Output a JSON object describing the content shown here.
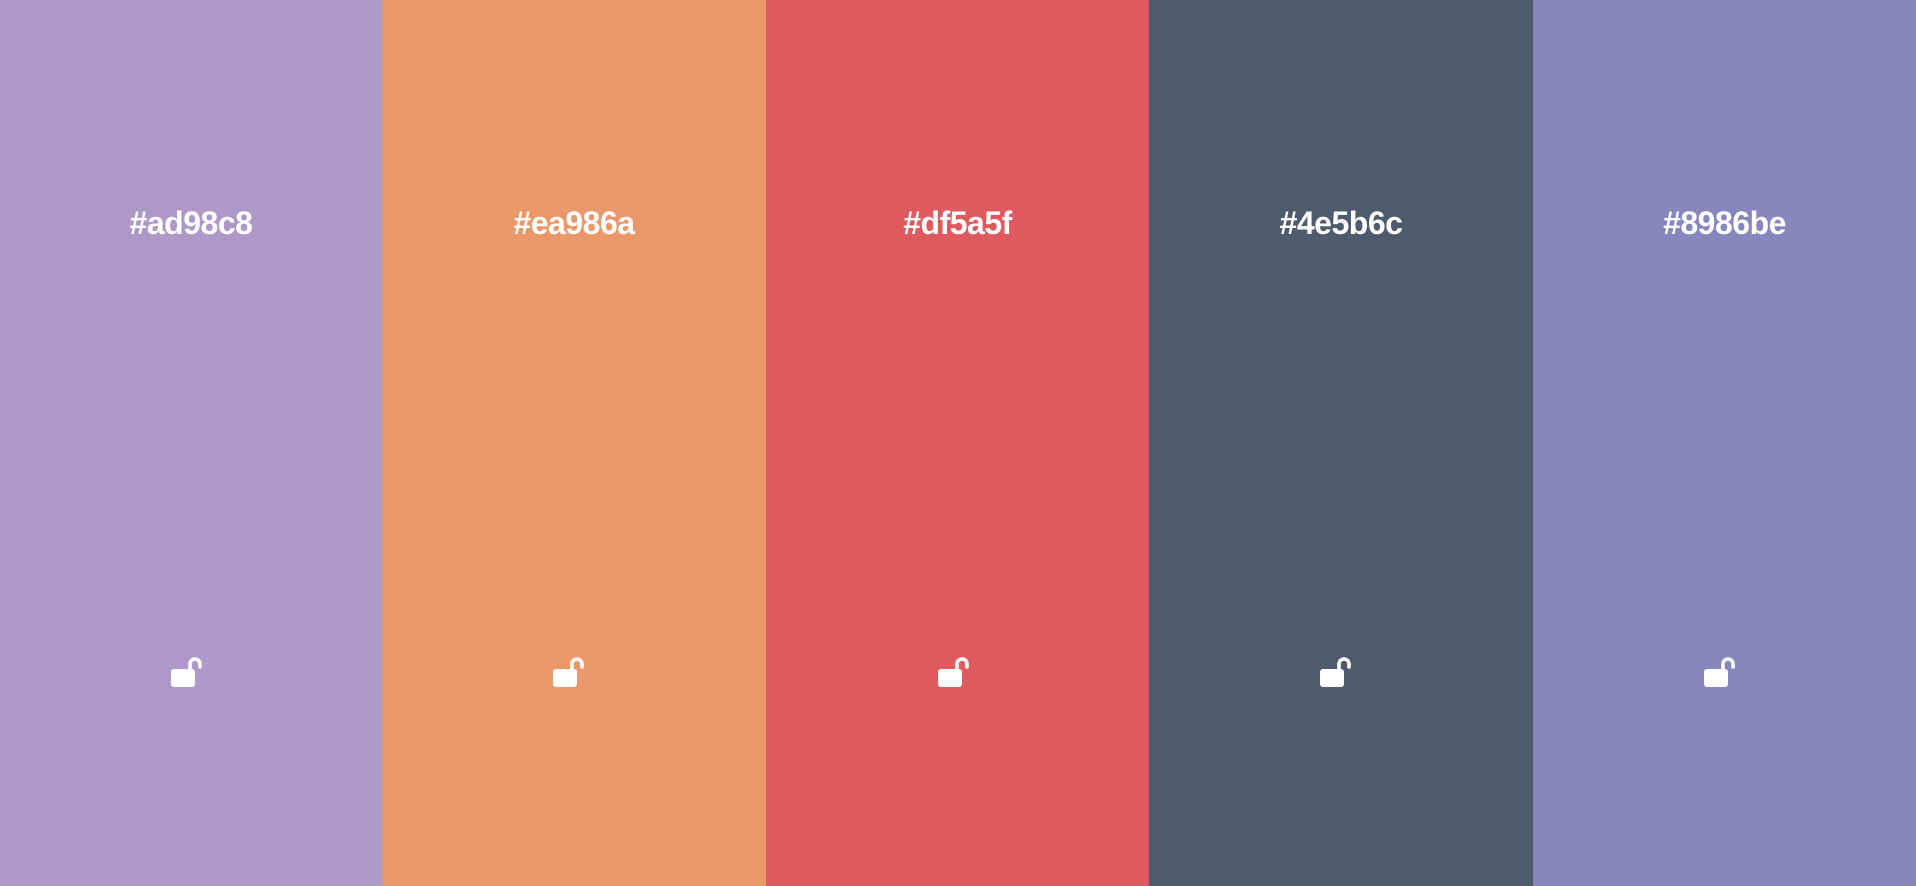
{
  "palette": {
    "colors": [
      {
        "hex": "#ad98c8",
        "locked": false,
        "icon": "unlock-icon"
      },
      {
        "hex": "#ea986a",
        "locked": false,
        "icon": "unlock-icon"
      },
      {
        "hex": "#df5a5f",
        "locked": false,
        "icon": "unlock-icon"
      },
      {
        "hex": "#4e5b6c",
        "locked": false,
        "icon": "unlock-icon"
      },
      {
        "hex": "#8986be",
        "locked": false,
        "icon": "unlock-icon"
      }
    ]
  }
}
